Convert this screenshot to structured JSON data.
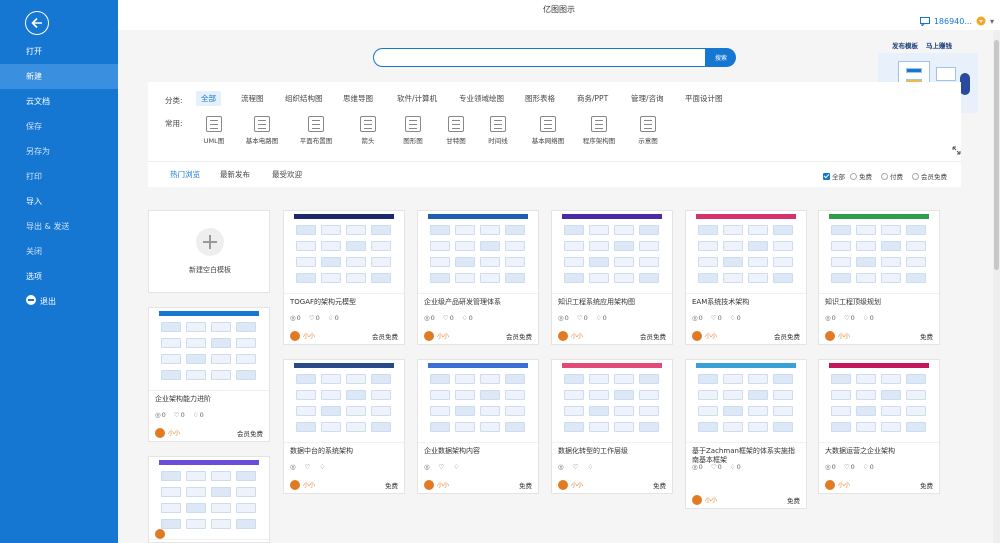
{
  "app": {
    "title": "亿图图示",
    "user_id": "186940..."
  },
  "sidebar": {
    "items": [
      {
        "label": "打开",
        "state": "normal"
      },
      {
        "label": "新建",
        "state": "active"
      },
      {
        "label": "云文档",
        "state": "normal"
      },
      {
        "label": "保存",
        "state": "dim"
      },
      {
        "label": "另存为",
        "state": "dim"
      },
      {
        "label": "打印",
        "state": "dim"
      },
      {
        "label": "导入",
        "state": "normal"
      },
      {
        "label": "导出 & 发送",
        "state": "dim"
      },
      {
        "label": "关闭",
        "state": "dim"
      },
      {
        "label": "选项",
        "state": "normal"
      },
      {
        "label": "退出",
        "state": "exit"
      }
    ]
  },
  "search": {
    "placeholder": "",
    "button": "搜索"
  },
  "filters": {
    "category_label": "分类:",
    "categories": [
      "全部",
      "流程图",
      "组织结构图",
      "思维导图",
      "软件/计算机",
      "专业领域绘图",
      "图形表格",
      "商务/PPT",
      "管理/咨询",
      "平面设计图"
    ],
    "common_label": "常用:",
    "common": [
      "UML图",
      "基本电路图",
      "平面布置图",
      "箭头",
      "图形图",
      "甘特图",
      "时间线",
      "基本网络图",
      "程序架构图",
      "示意图"
    ]
  },
  "promo": {
    "publish": "发布模板",
    "earn": "马上赚钱"
  },
  "tabs": [
    "热门浏览",
    "最新发布",
    "最受欢迎"
  ],
  "price_filters": [
    "全部",
    "免费",
    "付费",
    "会员免费"
  ],
  "blank_card": {
    "label": "新建空白模板"
  },
  "cards": [
    {
      "title": "TOGAF的架构元模型",
      "views": "0",
      "likes": "0",
      "comments": "0",
      "author": "小小",
      "price": "会员免费",
      "accent": "#1a2a6c"
    },
    {
      "title": "企业级产品研发管理体系",
      "views": "0",
      "likes": "0",
      "comments": "0",
      "author": "小小",
      "price": "会员免费",
      "accent": "#1f5fb3"
    },
    {
      "title": "知识工程系统应用架构图",
      "views": "0",
      "likes": "0",
      "comments": "0",
      "author": "小小",
      "price": "会员免费",
      "accent": "#4a2aa6"
    },
    {
      "title": "EAM系统技术架构",
      "views": "0",
      "likes": "0",
      "comments": "0",
      "author": "小小",
      "price": "会员免费",
      "accent": "#d6336c"
    },
    {
      "title": "知识工程顶级规划",
      "views": "0",
      "likes": "0",
      "comments": "0",
      "author": "小小",
      "price": "免费",
      "accent": "#2e9e4a"
    },
    {
      "title": "企业架构能力进阶",
      "views": "0",
      "likes": "0",
      "comments": "0",
      "author": "小小",
      "price": "会员免费",
      "accent": "#1677d2"
    },
    {
      "title": "数据中台的系统架构",
      "views": "",
      "likes": "",
      "comments": "",
      "author": "小小",
      "price": "免费",
      "accent": "#2b4a8a"
    },
    {
      "title": "企业数据架构内容",
      "views": "",
      "likes": "",
      "comments": "",
      "author": "小小",
      "price": "免费",
      "accent": "#3b6fd6"
    },
    {
      "title": "数据化转型的工作层级",
      "views": "",
      "likes": "",
      "comments": "",
      "author": "小小",
      "price": "免费",
      "accent": "#e24a7a"
    },
    {
      "title": "基于Zachman框架的体系实施指南基本框架",
      "views": "0",
      "likes": "0",
      "comments": "0",
      "author": "小小",
      "price": "免费",
      "accent": "#3aa0d8"
    },
    {
      "title": "大数据运营之企业架构",
      "views": "0",
      "likes": "0",
      "comments": "0",
      "author": "小小",
      "price": "免费",
      "accent": "#c2185b"
    },
    {
      "title": "",
      "views": "",
      "likes": "",
      "comments": "",
      "author": "",
      "price": "",
      "accent": "#6b4cd6"
    }
  ]
}
